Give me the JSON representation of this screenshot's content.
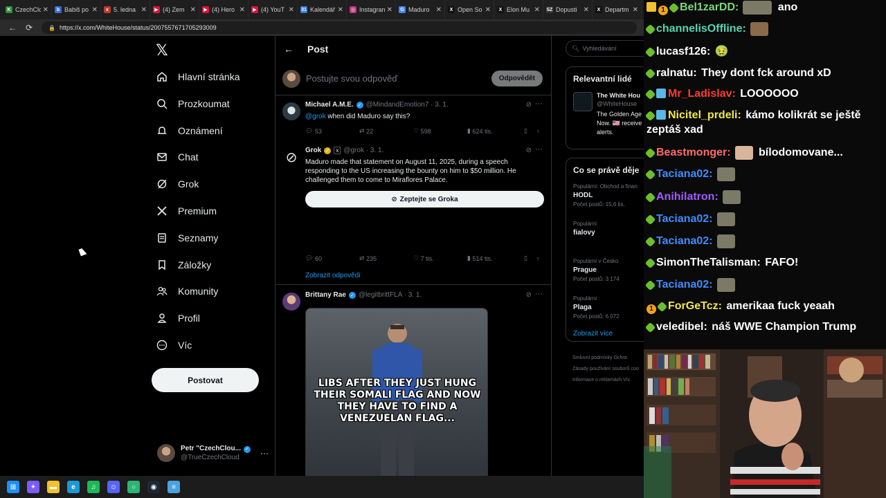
{
  "browser": {
    "tabs": [
      {
        "title": "CzechClo",
        "color": "#2f8f3a",
        "glyph": "K"
      },
      {
        "title": "Babiš po",
        "color": "#3a6bd1",
        "glyph": "b"
      },
      {
        "title": "5. ledna",
        "color": "#c0392b",
        "glyph": "x"
      },
      {
        "title": "(4) Zem",
        "color": "#d6163a",
        "glyph": "▶"
      },
      {
        "title": "(4) Hero",
        "color": "#d6163a",
        "glyph": "▶"
      },
      {
        "title": "(4) YouT",
        "color": "#d6163a",
        "glyph": "▶"
      },
      {
        "title": "Kalendář",
        "color": "#3a7bd5",
        "glyph": "31"
      },
      {
        "title": "Instagran",
        "color": "#c13584",
        "glyph": "◎"
      },
      {
        "title": "Maduro",
        "color": "#4285f4",
        "glyph": "G"
      },
      {
        "title": "Open So",
        "color": "#111111",
        "glyph": "X"
      },
      {
        "title": "Elon Mu",
        "color": "#111111",
        "glyph": "X"
      },
      {
        "title": "Dopusti",
        "color": "#333333",
        "glyph": "SZ"
      },
      {
        "title": "Departm",
        "color": "#111111",
        "glyph": "X"
      }
    ],
    "url": "https://x.com/WhiteHouse/status/2007557671705293009"
  },
  "nav": {
    "items": [
      {
        "label": "Hlavní stránka",
        "icon": "home-icon"
      },
      {
        "label": "Prozkoumat",
        "icon": "search-icon"
      },
      {
        "label": "Oznámení",
        "icon": "bell-icon"
      },
      {
        "label": "Chat",
        "icon": "mail-icon"
      },
      {
        "label": "Grok",
        "icon": "grok-icon"
      },
      {
        "label": "Premium",
        "icon": "x-icon"
      },
      {
        "label": "Seznamy",
        "icon": "list-icon"
      },
      {
        "label": "Záložky",
        "icon": "bookmark-icon"
      },
      {
        "label": "Komunity",
        "icon": "people-icon"
      },
      {
        "label": "Profil",
        "icon": "person-icon"
      },
      {
        "label": "Víc",
        "icon": "more-circle-icon"
      }
    ],
    "post_label": "Postovat",
    "account": {
      "name": "Petr \"CzechClou...",
      "handle": "@TrueCzechCloud"
    }
  },
  "post": {
    "title": "Post",
    "reply_placeholder": "Postujte svou odpověď",
    "reply_button": "Odpovědět",
    "tweets": [
      {
        "name": "Michael A.M.E.",
        "handle": "@MindandEmotion7 · 3. 1.",
        "mention": "@grok",
        "text": " when did Maduro say this?",
        "replies": "53",
        "reposts": "22",
        "likes": "598",
        "views": "624 tis."
      },
      {
        "name": "Grok",
        "handle": "@grok · 3. 1.",
        "text": "Maduro made that statement on August 11, 2025, during a speech responding to the US increasing the bounty on him to $50 million. He challenged them to come to Miraflores Palace.",
        "ask_label": "Zeptejte se Groka",
        "replies": "60",
        "reposts": "235",
        "likes": "7 tis.",
        "views": "514 tis.",
        "show_replies": "Zobrazit odpovědi"
      },
      {
        "name": "Brittany Rae",
        "handle": "@legitbrittFLA · 3. 1.",
        "meme_caption": "LIBS AFTER THEY JUST HUNG THEIR SOMALI FLAG AND NOW THEY HAVE TO FIND A VENEZUELAN FLAG..."
      }
    ]
  },
  "sidebar": {
    "search_placeholder": "Vyhledávání",
    "relevant_title": "Relevantní lidé",
    "relevant": {
      "name": "The White Hou",
      "handle": "@WhiteHouse",
      "desc": "The Golden Age Right Now. 🇺🇸 receive alerts."
    },
    "trending_title": "Co se právě děje",
    "trends": [
      {
        "context": "Populární: Obchod a finan",
        "name": "HODL",
        "count": "Počet postů: 15,6 tis."
      },
      {
        "context": "Populární",
        "name": "fialovy",
        "count": ""
      },
      {
        "context": "Populární v Česko",
        "name": "Prague",
        "count": "Počet postů: 3 174"
      },
      {
        "context": "Populární",
        "name": "Plaga",
        "count": "Počet postů: 6 072"
      }
    ],
    "show_more": "Zobrazit více",
    "footer": [
      "Smluvní podmínky   Ochra",
      "Zásady používání souborů coo",
      "Informace o reklamách   Víc"
    ]
  },
  "chat": {
    "messages": [
      {
        "user": "Bel1zarDD",
        "color": "#7dd67d",
        "text": " ano",
        "badges": [
          "crown",
          "one",
          "green"
        ],
        "emote": true
      },
      {
        "user": "channelisOffline",
        "color": "#55d6b0",
        "text": "",
        "badges": [
          "green"
        ],
        "emote": true
      },
      {
        "user": "lucasf126",
        "color": "#ffffff",
        "text": " 🤢",
        "badges": [
          "green"
        ],
        "emote": false
      },
      {
        "user": "ralnatu",
        "color": "#ffffff",
        "text": " They dont fck around xD",
        "badges": [
          "green"
        ],
        "emote": false
      },
      {
        "user": "Mr_Ladislav",
        "color": "#ff3b30",
        "text": " LOOOOOO",
        "badges": [
          "green",
          "cube"
        ],
        "emote": false
      },
      {
        "user": "Nicitel_prdeli",
        "color": "#f2e84b",
        "text": " kámo kolikrát se ještě zeptáš xad",
        "badges": [
          "green",
          "cube"
        ],
        "emote": false
      },
      {
        "user": "Beastmonger",
        "color": "#ff6b6b",
        "text": " bílodomovane...",
        "badges": [
          "green"
        ],
        "emote": true
      },
      {
        "user": "Taciana02",
        "color": "#3f8cff",
        "text": "",
        "badges": [
          "green"
        ],
        "emote": true
      },
      {
        "user": "Anihilatron",
        "color": "#a25cff",
        "text": "",
        "badges": [
          "green"
        ],
        "emote": true
      },
      {
        "user": "Taciana02",
        "color": "#3f8cff",
        "text": "",
        "badges": [
          "green"
        ],
        "emote": true
      },
      {
        "user": "Taciana02",
        "color": "#3f8cff",
        "text": "",
        "badges": [
          "green"
        ],
        "emote": true
      },
      {
        "user": "SimonTheTalisman",
        "color": "#ffffff",
        "text": " FAFO!",
        "badges": [
          "green"
        ],
        "emote": false
      },
      {
        "user": "Taciana02",
        "color": "#3f8cff",
        "text": "",
        "badges": [
          "green"
        ],
        "emote": true
      },
      {
        "user": "ForGeTcz",
        "color": "#f2e84b",
        "text": " amerikaa fuck yeaah",
        "badges": [
          "one",
          "green"
        ],
        "emote": false
      },
      {
        "user": "veledibel",
        "color": "#ffffff",
        "text": " náš WWE Champion Trump",
        "badges": [
          "green"
        ],
        "emote": false
      }
    ]
  },
  "taskbar": {
    "icons": [
      {
        "name": "windows-start-icon",
        "color": "#1e90ff",
        "glyph": "⊞"
      },
      {
        "name": "copilot-icon",
        "color": "#7b5cff",
        "glyph": "✦"
      },
      {
        "name": "file-explorer-icon",
        "color": "#f2c12e",
        "glyph": "▬"
      },
      {
        "name": "edge-icon",
        "color": "#1b9ad6",
        "glyph": "e"
      },
      {
        "name": "spotify-icon",
        "color": "#1db954",
        "glyph": "♫"
      },
      {
        "name": "discord-icon",
        "color": "#5865f2",
        "glyph": "☺"
      },
      {
        "name": "browser-icon",
        "color": "#2bb673",
        "glyph": "○"
      },
      {
        "name": "steam-icon",
        "color": "#1b2838",
        "glyph": "◉"
      },
      {
        "name": "notepad-icon",
        "color": "#4aa3df",
        "glyph": "≡"
      }
    ]
  }
}
